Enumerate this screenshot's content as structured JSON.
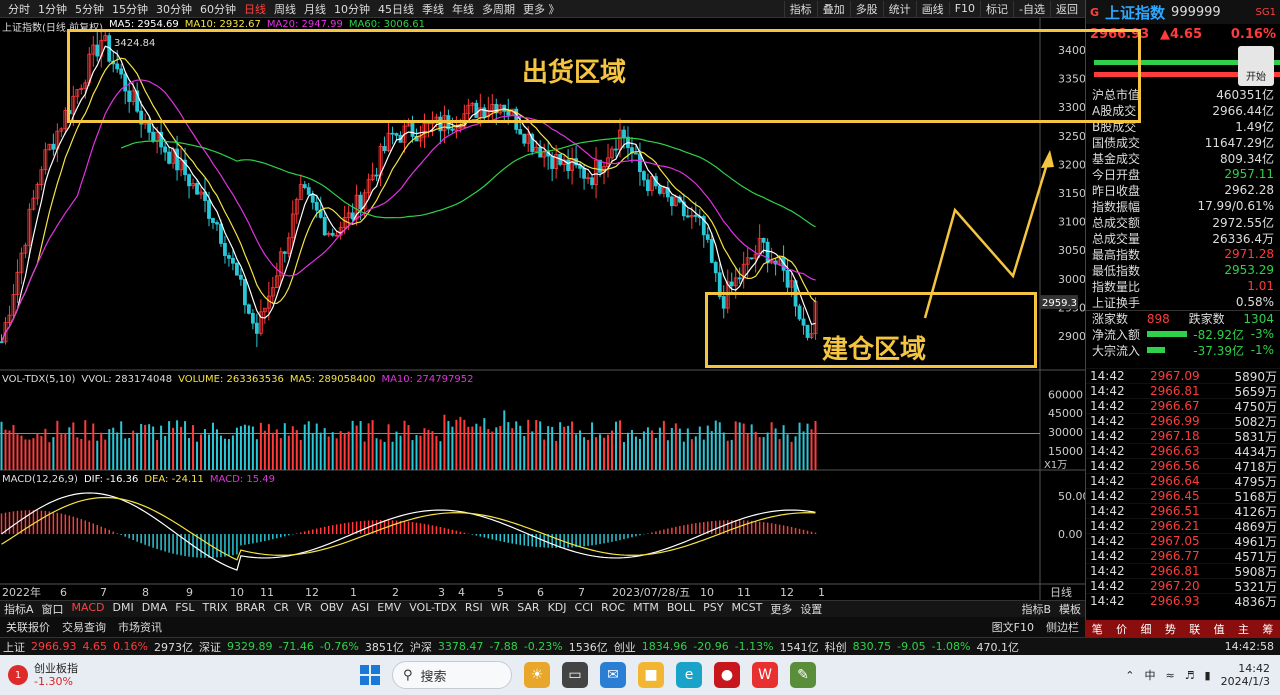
{
  "topbar": {
    "periods": [
      "分时",
      "1分钟",
      "5分钟",
      "15分钟",
      "30分钟",
      "60分钟",
      "日线",
      "周线",
      "月线",
      "10分钟",
      "45日线",
      "季线",
      "年线",
      "多周期",
      "更多 》"
    ],
    "active_period": "日线",
    "tools": [
      "指标",
      "叠加",
      "多股",
      "统计",
      "画线",
      "F10",
      "标记",
      "-自选",
      "返回"
    ]
  },
  "legend": {
    "title": "上证指数(日线,前复权)",
    "ma5": "MA5: 2954.69",
    "ma10": "MA10: 2932.67",
    "ma20": "MA20: 2947.99",
    "ma60": "MA60: 3006.61",
    "vol_title": "VOL-TDX(5,10)",
    "vvol": "VVOL: 283174048",
    "volume": "VOLUME: 263363536",
    "vma5": "MA5: 289058400",
    "vma10": "MA10: 274797952",
    "macd_title": "MACD(12,26,9)",
    "dif": "DIF: -16.36",
    "dea": "DEA: -24.11",
    "macd": "MACD: 15.49"
  },
  "price_axis": [
    "3400",
    "3350",
    "3300",
    "3250",
    "3200",
    "3150",
    "3100",
    "3050",
    "3000",
    "2950",
    "2900"
  ],
  "current_price_tag": "2959.3",
  "high_label": "3424.84",
  "vol_axis": [
    "60000",
    "45000",
    "30000",
    "15000"
  ],
  "vol_unit": "X1万",
  "macd_axis": [
    "50.00",
    "0.00"
  ],
  "x_axis": [
    "2022年",
    "6",
    "7",
    "8",
    "9",
    "10",
    "11",
    "12",
    "1",
    "2",
    "3",
    "4",
    "5",
    "6",
    "7",
    "2023/07/28/五",
    "10",
    "11",
    "12",
    "1"
  ],
  "annotations": {
    "distribution": "出货区域",
    "accumulation": "建仓区域"
  },
  "colors": {
    "up": "#ff3b3b",
    "down": "#2ac7d6",
    "zone": "#f5c542",
    "ma5": "#ffffff",
    "ma10": "#f5e342",
    "ma20": "#e033e0",
    "ma60": "#2fd14b"
  },
  "right_panel": {
    "g": "G",
    "name": "上证指数",
    "code": "999999",
    "tag": "SG1",
    "price": "2966.93",
    "change": "▲4.65",
    "pct": "0.16%",
    "rows": [
      {
        "k": "沪总市值",
        "v": "460351亿",
        "c": ""
      },
      {
        "k": "A股成交",
        "v": "2966.44亿",
        "c": ""
      },
      {
        "k": "B股成交",
        "v": "1.49亿",
        "c": ""
      },
      {
        "k": "国债成交",
        "v": "11647.29亿",
        "c": ""
      },
      {
        "k": "基金成交",
        "v": "809.34亿",
        "c": ""
      },
      {
        "k": "今日开盘",
        "v": "2957.11",
        "c": "green"
      },
      {
        "k": "昨日收盘",
        "v": "2962.28",
        "c": ""
      },
      {
        "k": "指数振幅",
        "v": "17.99/0.61%",
        "c": ""
      },
      {
        "k": "总成交额",
        "v": "2972.55亿",
        "c": ""
      },
      {
        "k": "总成交量",
        "v": "26336.4万",
        "c": ""
      },
      {
        "k": "最高指数",
        "v": "2971.28",
        "c": "red"
      },
      {
        "k": "最低指数",
        "v": "2953.29",
        "c": "green"
      },
      {
        "k": "指数量比",
        "v": "1.01",
        "c": "red"
      },
      {
        "k": "上证换手",
        "v": "0.58%",
        "c": ""
      }
    ],
    "up_label": "涨家数",
    "up_count": "898",
    "down_label": "跌家数",
    "down_count": "1304",
    "net_inflow_label": "净流入额",
    "net_inflow": "-82.92亿",
    "net_inflow_pct": "-3%",
    "big_inflow_label": "大宗流入",
    "big_inflow": "-37.39亿",
    "big_inflow_pct": "-1%",
    "open_btn": "开始",
    "ticks": [
      {
        "t": "14:42",
        "p": "2967.09",
        "v": "5890万"
      },
      {
        "t": "14:42",
        "p": "2966.81",
        "v": "5659万"
      },
      {
        "t": "14:42",
        "p": "2966.67",
        "v": "4750万"
      },
      {
        "t": "14:42",
        "p": "2966.99",
        "v": "5082万"
      },
      {
        "t": "14:42",
        "p": "2967.18",
        "v": "5831万"
      },
      {
        "t": "14:42",
        "p": "2966.63",
        "v": "4434万"
      },
      {
        "t": "14:42",
        "p": "2966.56",
        "v": "4718万"
      },
      {
        "t": "14:42",
        "p": "2966.64",
        "v": "4795万"
      },
      {
        "t": "14:42",
        "p": "2966.45",
        "v": "5168万"
      },
      {
        "t": "14:42",
        "p": "2966.51",
        "v": "4126万"
      },
      {
        "t": "14:42",
        "p": "2966.21",
        "v": "4869万"
      },
      {
        "t": "14:42",
        "p": "2967.05",
        "v": "4961万"
      },
      {
        "t": "14:42",
        "p": "2966.77",
        "v": "4571万"
      },
      {
        "t": "14:42",
        "p": "2966.81",
        "v": "5908万"
      },
      {
        "t": "14:42",
        "p": "2967.20",
        "v": "5321万"
      },
      {
        "t": "14:42",
        "p": "2966.93",
        "v": "4836万"
      }
    ],
    "bottom_tabs": [
      "笔",
      "价",
      "细",
      "势",
      "联",
      "值",
      "主",
      "筹"
    ]
  },
  "indicator_tabs": [
    "指标A",
    "窗口",
    "MACD",
    "DMI",
    "DMA",
    "FSL",
    "TRIX",
    "BRAR",
    "CR",
    "VR",
    "OBV",
    "ASI",
    "EMV",
    "VOL-TDX",
    "RSI",
    "WR",
    "SAR",
    "KDJ",
    "CCI",
    "ROC",
    "MTM",
    "BOLL",
    "PSY",
    "MCST",
    "更多",
    "设置"
  ],
  "active_indicator": "MACD",
  "indicator_right": [
    "指标B",
    "模板"
  ],
  "links": [
    "关联报价",
    "交易查询",
    "市场资讯"
  ],
  "links_right": [
    "图文F10",
    "侧边栏"
  ],
  "ticker": [
    {
      "n": "上证",
      "p": "2966.93",
      "c": "4.65",
      "pct": "0.16%",
      "amt": "2973亿",
      "dir": "up"
    },
    {
      "n": "深证",
      "p": "9329.89",
      "c": "-71.46",
      "pct": "-0.76%",
      "amt": "3851亿",
      "dir": "down"
    },
    {
      "n": "沪深",
      "p": "3378.47",
      "c": "-7.88",
      "pct": "-0.23%",
      "amt": "1536亿",
      "dir": "down"
    },
    {
      "n": "创业",
      "p": "1834.96",
      "c": "-20.96",
      "pct": "-1.13%",
      "amt": "1541亿",
      "dir": "down"
    },
    {
      "n": "科创",
      "p": "830.75",
      "c": "-9.05",
      "pct": "-1.08%",
      "amt": "470.1亿",
      "dir": "down"
    }
  ],
  "ticker_time": "14:42:58",
  "taskbar": {
    "badge": "1",
    "app_name": "创业板指",
    "app_change": "-1.30%",
    "search": "搜索",
    "time": "14:42",
    "date": "2024/1/3",
    "lang": "中"
  }
}
